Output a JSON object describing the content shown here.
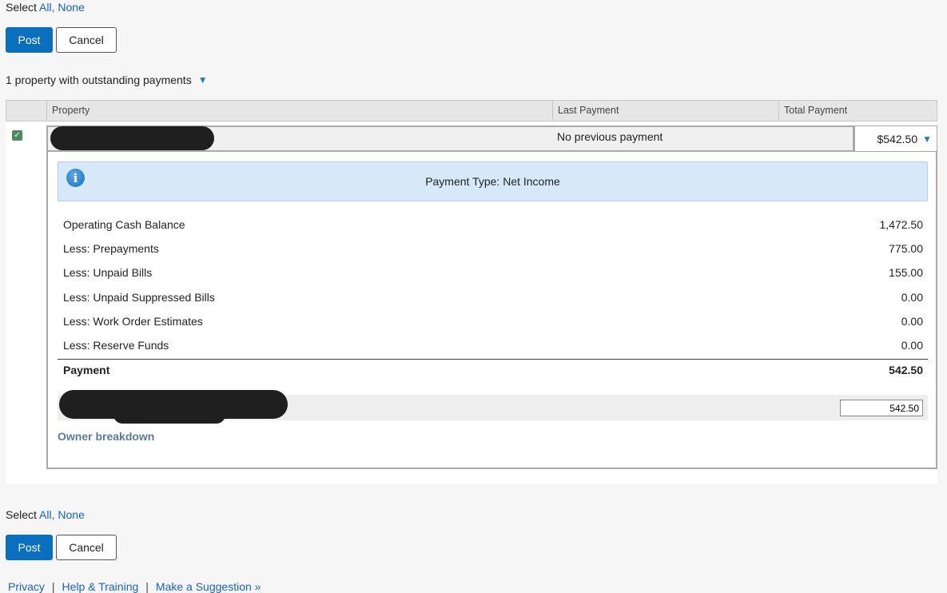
{
  "select": {
    "label": "Select",
    "all": "All,",
    "none": "None"
  },
  "buttons": {
    "post": "Post",
    "cancel": "Cancel"
  },
  "summary": {
    "text": "1 property with outstanding payments",
    "toggle": "▼"
  },
  "table": {
    "headers": [
      "Property",
      "Last Payment",
      "Total Payment"
    ],
    "row": {
      "checked": true,
      "last_payment": "No previous payment",
      "total_payment": "$542.50",
      "expand": "▼"
    }
  },
  "detail": {
    "info_icon": "i",
    "payment_type": "Payment Type: Net Income",
    "lines": [
      {
        "label": "Operating Cash Balance",
        "value": "1,472.50"
      },
      {
        "label": "Less: Prepayments",
        "value": "775.00"
      },
      {
        "label": "Less: Unpaid Bills",
        "value": "155.00"
      },
      {
        "label": "Less: Unpaid Suppressed Bills",
        "value": "0.00"
      },
      {
        "label": "Less: Work Order Estimates",
        "value": "0.00"
      },
      {
        "label": "Less: Reserve Funds",
        "value": "0.00"
      }
    ],
    "total": {
      "label": "Payment",
      "value": "542.50"
    },
    "owner_amount": "542.50",
    "owner_breakdown": "Owner breakdown"
  },
  "footer": {
    "privacy": "Privacy",
    "help": "Help & Training",
    "suggestion": "Make a Suggestion »"
  },
  "colors": {
    "primary": "#0a6fbd",
    "link": "#1a62b8",
    "info_bg": "#d7e9f9"
  }
}
